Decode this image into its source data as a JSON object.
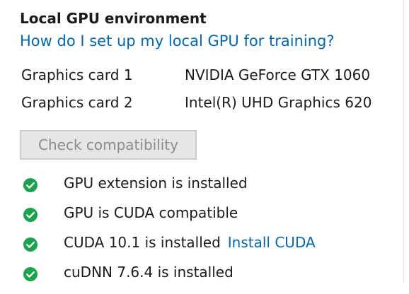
{
  "section": {
    "title": "Local GPU environment",
    "help_link": "How do I set up my local GPU for training?"
  },
  "graphics_cards": [
    {
      "label": "Graphics card 1",
      "value": "NVIDIA GeForce GTX 1060"
    },
    {
      "label": "Graphics card 2",
      "value": "Intel(R) UHD Graphics 620"
    }
  ],
  "check_button": {
    "label": "Check compatibility",
    "enabled": false
  },
  "status_items": [
    {
      "text": "GPU extension is installed",
      "icon": "check-circle-icon",
      "link": ""
    },
    {
      "text": "GPU is CUDA compatible",
      "icon": "check-circle-icon",
      "link": ""
    },
    {
      "text": "CUDA 10.1 is installed",
      "icon": "check-circle-icon",
      "link": "Install CUDA"
    },
    {
      "text": "cuDNN 7.6.4 is installed",
      "icon": "check-circle-icon",
      "link": ""
    }
  ],
  "colors": {
    "accent_link": "#0067b8",
    "success_green": "#17a44a",
    "disabled_button_bg": "#e6e6e6",
    "disabled_button_text": "#8c8c8c"
  }
}
